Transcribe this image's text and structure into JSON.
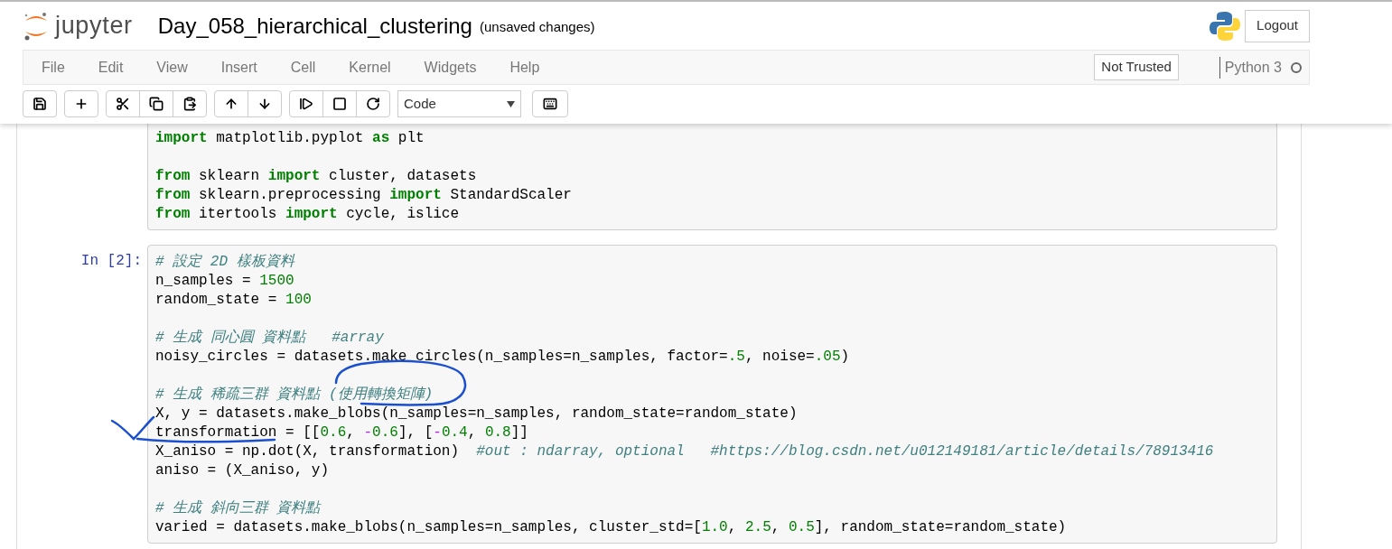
{
  "header": {
    "logo_text": "jupyter",
    "notebook_name": "Day_058_hierarchical_clustering",
    "save_status": "(unsaved changes)",
    "logout": "Logout"
  },
  "menu": [
    "File",
    "Edit",
    "View",
    "Insert",
    "Cell",
    "Kernel",
    "Widgets",
    "Help"
  ],
  "trust": "Not Trusted",
  "kernel": {
    "name": "Python 3",
    "busy": false
  },
  "toolbar": {
    "cell_type": "Code"
  },
  "cells": [
    {
      "lines": [
        {
          "tokens": [
            {
              "kind": "keyword",
              "t": "import"
            },
            {
              "kind": "plain",
              "t": " matplotlib.pyplot "
            },
            {
              "kind": "keyword",
              "t": "as"
            },
            {
              "kind": "plain",
              "t": " plt"
            }
          ]
        },
        {
          "gap_before": true,
          "tokens": [
            {
              "kind": "keyword",
              "t": "from"
            },
            {
              "kind": "plain",
              "t": " sklearn "
            },
            {
              "kind": "keyword",
              "t": "import"
            },
            {
              "kind": "plain",
              "t": " cluster, datasets"
            }
          ]
        },
        {
          "tokens": [
            {
              "kind": "keyword",
              "t": "from"
            },
            {
              "kind": "plain",
              "t": " sklearn.preprocessing "
            },
            {
              "kind": "keyword",
              "t": "import"
            },
            {
              "kind": "plain",
              "t": " StandardScaler"
            }
          ]
        },
        {
          "tokens": [
            {
              "kind": "keyword",
              "t": "from"
            },
            {
              "kind": "plain",
              "t": " itertools "
            },
            {
              "kind": "keyword",
              "t": "import"
            },
            {
              "kind": "plain",
              "t": " cycle, islice"
            }
          ]
        }
      ]
    },
    {
      "prompt": "In [2]:",
      "lines": [
        {
          "tokens": [
            {
              "kind": "comment",
              "t": "# 設定 2D 樣板資料"
            }
          ]
        },
        {
          "tokens": [
            {
              "kind": "plain",
              "t": "n_samples = "
            },
            {
              "kind": "number",
              "t": "1500"
            }
          ]
        },
        {
          "tokens": [
            {
              "kind": "plain",
              "t": "random_state = "
            },
            {
              "kind": "number",
              "t": "100"
            }
          ]
        },
        {
          "gap_before": true,
          "tokens": [
            {
              "kind": "comment",
              "t": "# 生成 同心圓 資料點   #array"
            }
          ]
        },
        {
          "tokens": [
            {
              "kind": "plain",
              "t": "noisy_circles = datasets.make_circles(n_samples=n_samples, factor="
            },
            {
              "kind": "number",
              "t": ".5"
            },
            {
              "kind": "plain",
              "t": ", noise="
            },
            {
              "kind": "number",
              "t": ".05"
            },
            {
              "kind": "plain",
              "t": ")"
            }
          ]
        },
        {
          "gap_before": true,
          "tokens": [
            {
              "kind": "comment",
              "t": "# 生成 稀疏三群 資料點 (使用轉換矩陣)"
            }
          ]
        },
        {
          "tokens": [
            {
              "kind": "plain",
              "t": "X, y = datasets.make_blobs(n_samples=n_samples, random_state=random_state)"
            }
          ]
        },
        {
          "tokens": [
            {
              "kind": "plain",
              "t": "transformation = [["
            },
            {
              "kind": "number",
              "t": "0.6"
            },
            {
              "kind": "plain",
              "t": ", "
            },
            {
              "kind": "operator",
              "t": "-"
            },
            {
              "kind": "number",
              "t": "0.6"
            },
            {
              "kind": "plain",
              "t": "], ["
            },
            {
              "kind": "operator",
              "t": "-"
            },
            {
              "kind": "number",
              "t": "0.4"
            },
            {
              "kind": "plain",
              "t": ", "
            },
            {
              "kind": "number",
              "t": "0.8"
            },
            {
              "kind": "plain",
              "t": "]]"
            }
          ]
        },
        {
          "tokens": [
            {
              "kind": "plain",
              "t": "X_aniso = np.dot(X, transformation)  "
            },
            {
              "kind": "comment",
              "t": "#out : ndarray, optional   #https://blog.csdn.net/u012149181/article/details/78913416"
            }
          ]
        },
        {
          "tokens": [
            {
              "kind": "plain",
              "t": "aniso = (X_aniso, y)"
            }
          ]
        },
        {
          "gap_before": true,
          "tokens": [
            {
              "kind": "comment",
              "t": "# 生成 斜向三群 資料點"
            }
          ]
        },
        {
          "tokens": [
            {
              "kind": "plain",
              "t": "varied = datasets.make_blobs(n_samples=n_samples, cluster_std=["
            },
            {
              "kind": "number",
              "t": "1.0"
            },
            {
              "kind": "plain",
              "t": ", "
            },
            {
              "kind": "number",
              "t": "2.5"
            },
            {
              "kind": "plain",
              "t": ", "
            },
            {
              "kind": "number",
              "t": "0.5"
            },
            {
              "kind": "plain",
              "t": "], random_state=random_state)"
            }
          ]
        }
      ]
    }
  ]
}
